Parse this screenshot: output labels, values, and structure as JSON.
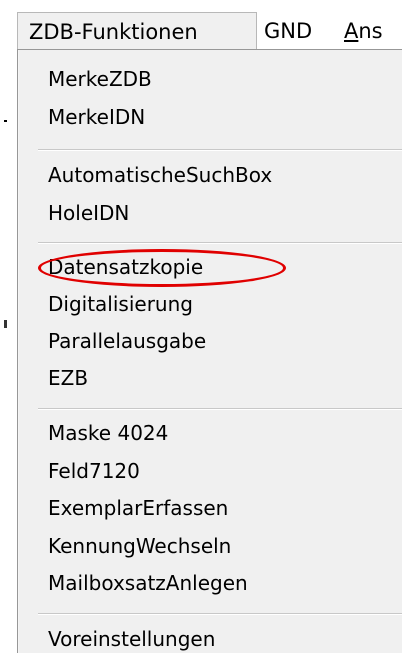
{
  "menubar": {
    "items": [
      {
        "label": "ZDB-Funktionen"
      },
      {
        "label": "GND"
      },
      {
        "label_accel": "A",
        "label_rest": "ns"
      }
    ]
  },
  "dropdown": {
    "groups": [
      {
        "items": [
          "MerkeZDB",
          "MerkeIDN"
        ]
      },
      {
        "items": [
          "AutomatischeSuchBox",
          "HoleIDN"
        ]
      },
      {
        "items": [
          "Datensatzkopie",
          "Digitalisierung",
          "Parallelausgabe",
          "EZB"
        ]
      },
      {
        "items": [
          "Maske 4024",
          "Feld7120",
          "ExemplarErfassen",
          "KennungWechseln",
          "MailboxsatzAnlegen"
        ]
      },
      {
        "items": [
          "Voreinstellungen"
        ]
      }
    ]
  },
  "annotation": {
    "color": "#e00000",
    "target_item": "Datensatzkopie"
  }
}
